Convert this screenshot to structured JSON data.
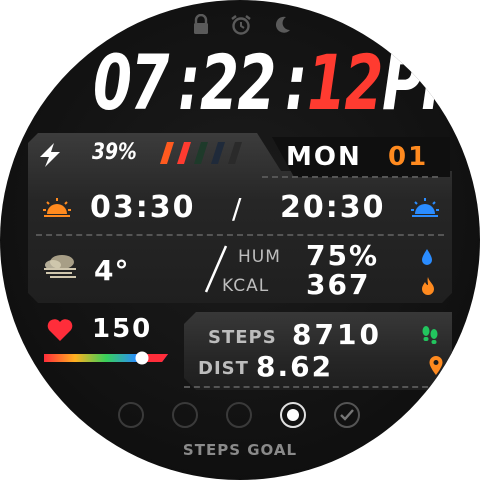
{
  "status": {
    "icons": [
      "lock-icon",
      "alarm-icon",
      "moon-icon"
    ]
  },
  "time": {
    "hours": "07",
    "sep1": ":",
    "minutes": "22",
    "sep2": ":",
    "seconds": "12",
    "ampm": "PM"
  },
  "battery": {
    "percent_label": "39%",
    "percent": 39,
    "icon": "lightning-icon",
    "segments": [
      "#ff5a1f",
      "#ff3b30",
      "#1e3a2a",
      "#1f2a3a",
      "#2a2a2a"
    ]
  },
  "date": {
    "day": "MON",
    "number": "01"
  },
  "sun": {
    "sunrise": "03:30",
    "separator": "/",
    "sunset": "20:30"
  },
  "weather": {
    "icon": "fog-icon",
    "temperature": "4°"
  },
  "metrics": {
    "hum_label": "HUM",
    "hum_value": "75%",
    "kcal_label": "KCAL",
    "kcal_value": "367"
  },
  "heart": {
    "bpm": "150",
    "level": 0.8
  },
  "activity": {
    "steps_label": "STEPS",
    "steps_value": "8710",
    "dist_label": "DIST",
    "dist_value": "8.62"
  },
  "goal": {
    "label": "STEPS GOAL",
    "filled": 4,
    "total": 5
  },
  "colors": {
    "accent_red": "#ff3b30",
    "accent_orange": "#ff8a1f",
    "accent_blue": "#2a8cff",
    "accent_green": "#22c55e",
    "text": "#ffffff"
  }
}
